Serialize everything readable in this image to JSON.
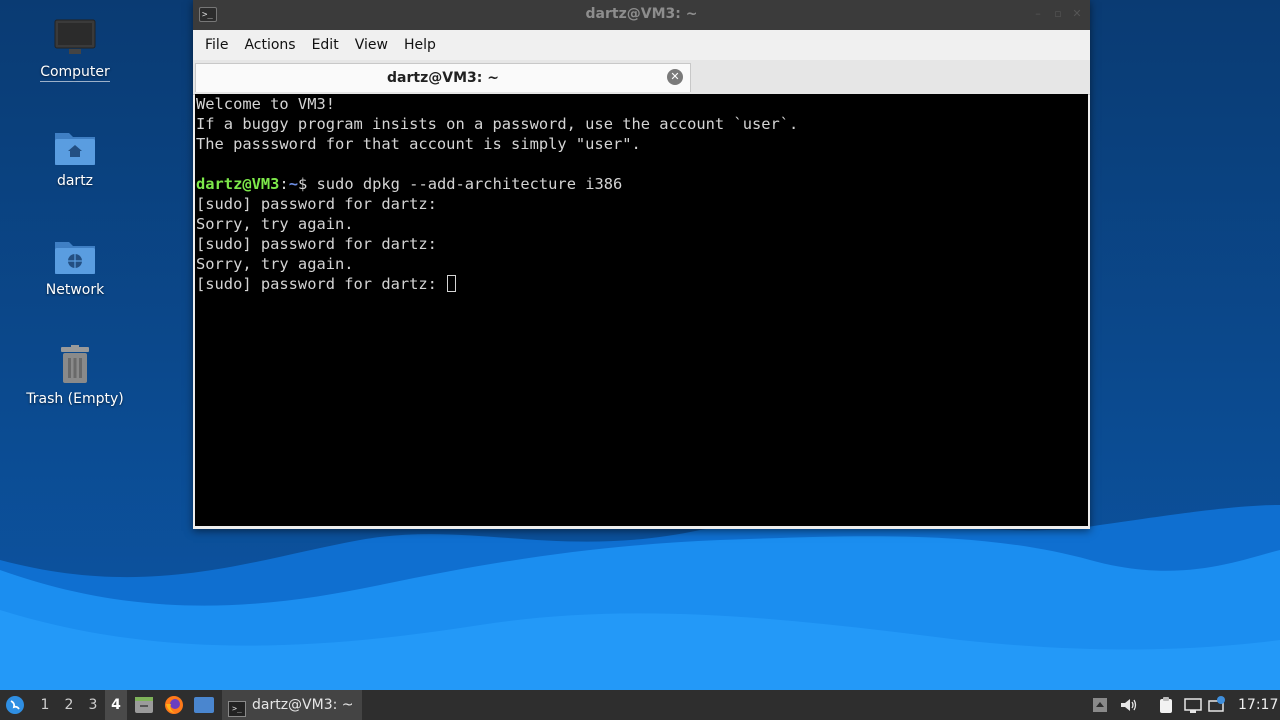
{
  "desktop": {
    "icons": [
      {
        "label": "Computer",
        "icon": "computer-icon"
      },
      {
        "label": "dartz",
        "icon": "home-folder-icon"
      },
      {
        "label": "Network",
        "icon": "network-folder-icon"
      },
      {
        "label": "Trash (Empty)",
        "icon": "trash-icon"
      }
    ]
  },
  "window": {
    "title": "dartz@VM3: ~",
    "menu": [
      "File",
      "Actions",
      "Edit",
      "View",
      "Help"
    ],
    "tab_title": "dartz@VM3: ~"
  },
  "terminal": {
    "motd": [
      "Welcome to VM3!",
      "If a buggy program insists on a password, use the account `user`.",
      "The passsword for that account is simply \"user\"."
    ],
    "prompt_user": "dartz@VM3",
    "prompt_path": "~",
    "prompt_symbol": "$",
    "command": " sudo dpkg --add-architecture i386",
    "output": [
      "[sudo] password for dartz:",
      "Sorry, try again.",
      "[sudo] password for dartz:",
      "Sorry, try again."
    ],
    "current_line": "[sudo] password for dartz: "
  },
  "taskbar": {
    "workspaces": [
      "1",
      "2",
      "3",
      "4"
    ],
    "active_workspace": "4",
    "task_label": "dartz@VM3: ~",
    "clock": "17:17"
  },
  "colors": {
    "prompt_user": "#7de84a",
    "prompt_path": "#6e8fe6",
    "terminal_bg": "#000000",
    "wallpaper_wave": "#1b8ef0"
  }
}
